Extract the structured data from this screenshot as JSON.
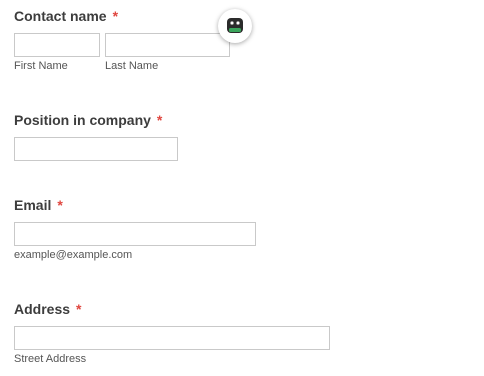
{
  "contact_name": {
    "label": "Contact name",
    "required_mark": "*",
    "first_name": {
      "value": "",
      "sublabel": "First Name"
    },
    "last_name": {
      "value": "",
      "sublabel": "Last Name"
    }
  },
  "position": {
    "label": "Position in company",
    "required_mark": "*",
    "value": ""
  },
  "email": {
    "label": "Email",
    "required_mark": "*",
    "value": "",
    "sublabel": "example@example.com"
  },
  "address": {
    "label": "Address",
    "required_mark": "*",
    "street": {
      "value": "",
      "sublabel": "Street Address"
    }
  },
  "assistant_badge": {
    "icon": "robot-icon",
    "accent_color": "#3ba55c"
  },
  "colors": {
    "required": "#e0463f",
    "border": "#c9c9c9",
    "label": "#3d3d3d"
  }
}
